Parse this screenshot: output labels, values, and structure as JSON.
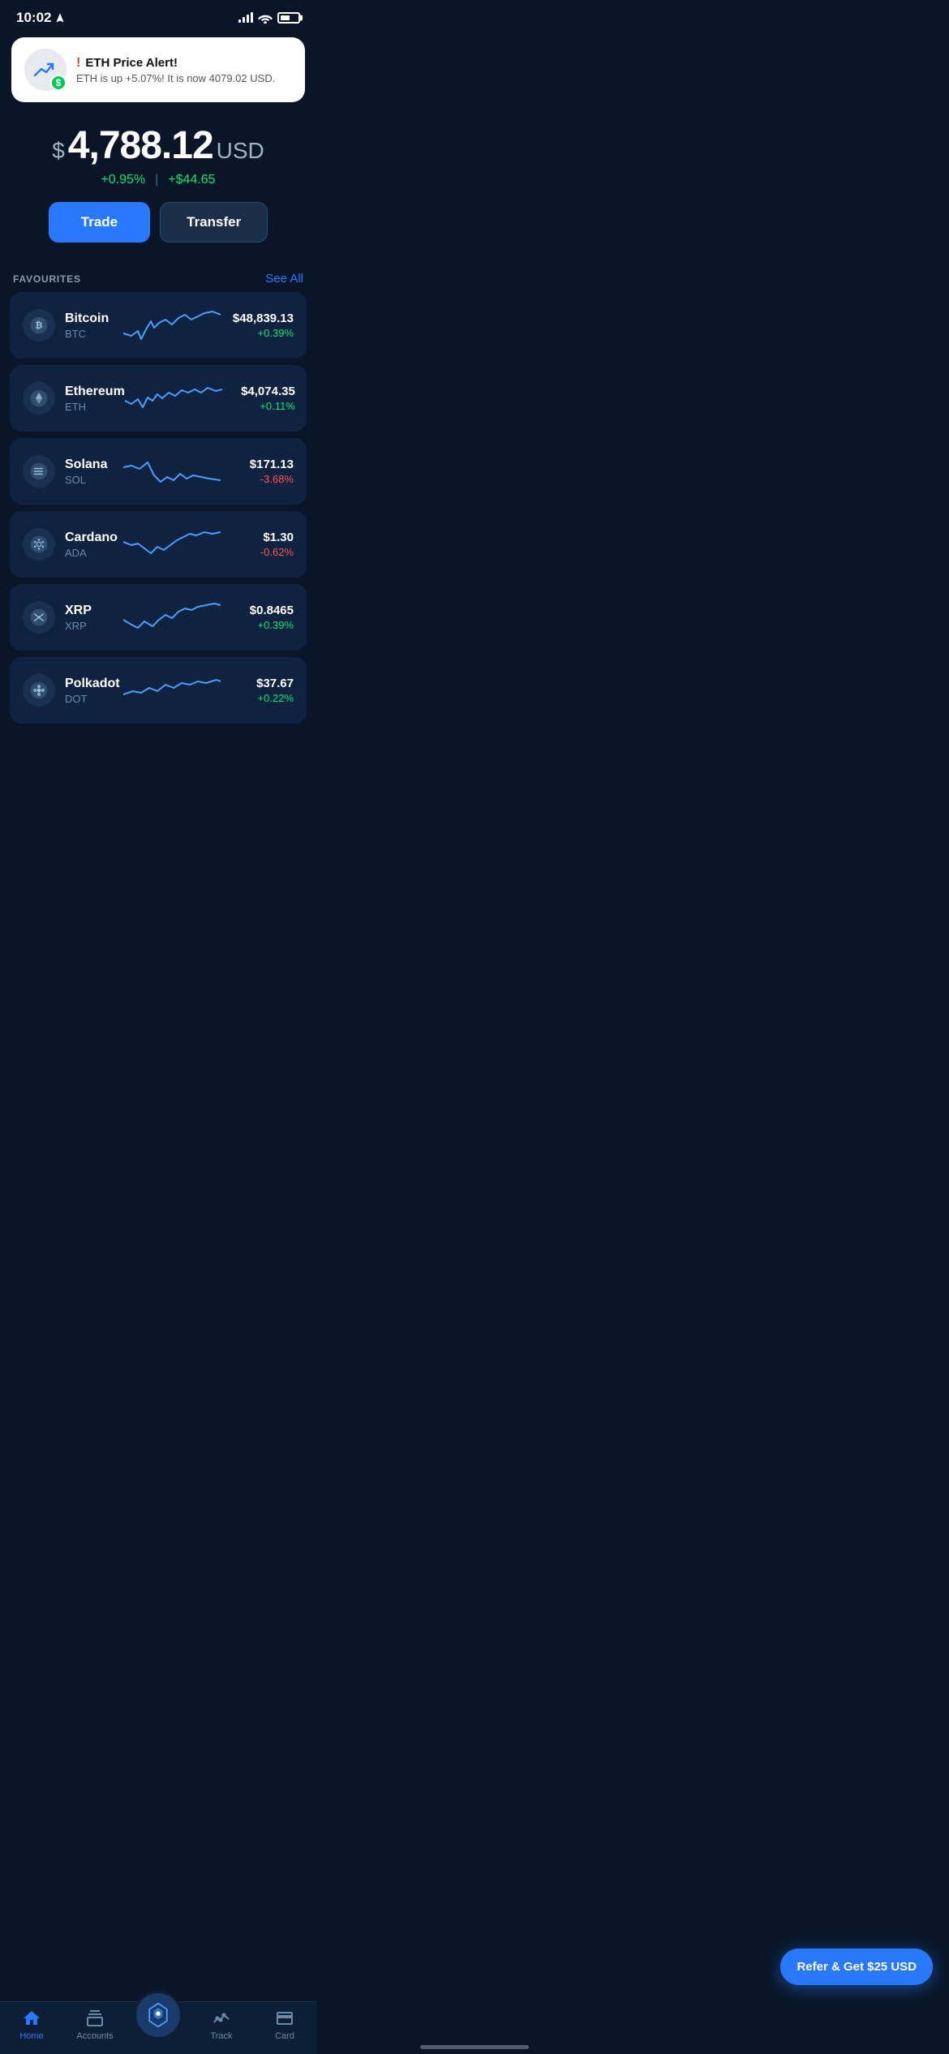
{
  "status_bar": {
    "time": "10:02",
    "location_icon": "navigation-icon"
  },
  "notification": {
    "title": "ETH Price Alert!",
    "exclaim": "!",
    "body": "ETH is up +5.07%! It is now 4079.02 USD.",
    "dollar_symbol": "$"
  },
  "portfolio": {
    "dollar_sign": "$",
    "value": "4,788.12",
    "currency": "USD",
    "change_pct": "+0.95%",
    "change_abs": "+$44.65",
    "trade_label": "Trade",
    "transfer_label": "Transfer"
  },
  "favourites": {
    "title": "FAVOURITES",
    "see_all": "See All",
    "coins": [
      {
        "name": "Bitcoin",
        "symbol": "BTC",
        "price": "$48,839.13",
        "change": "+0.39%",
        "positive": true
      },
      {
        "name": "Ethereum",
        "symbol": "ETH",
        "price": "$4,074.35",
        "change": "+0.11%",
        "positive": true
      },
      {
        "name": "Solana",
        "symbol": "SOL",
        "price": "$171.13",
        "change": "-3.68%",
        "positive": false
      },
      {
        "name": "Cardano",
        "symbol": "ADA",
        "price": "$1.30",
        "change": "-0.62%",
        "positive": false
      },
      {
        "name": "XRP",
        "symbol": "XRP",
        "price": "$0.8465",
        "change": "+0.39%",
        "positive": true
      },
      {
        "name": "Polkadot",
        "symbol": "DOT",
        "price": "$37.67",
        "change": "",
        "positive": true
      }
    ]
  },
  "refer": {
    "label": "Refer & Get $25 USD"
  },
  "nav": {
    "home": "Home",
    "accounts": "Accounts",
    "track": "Track",
    "card": "Card"
  }
}
